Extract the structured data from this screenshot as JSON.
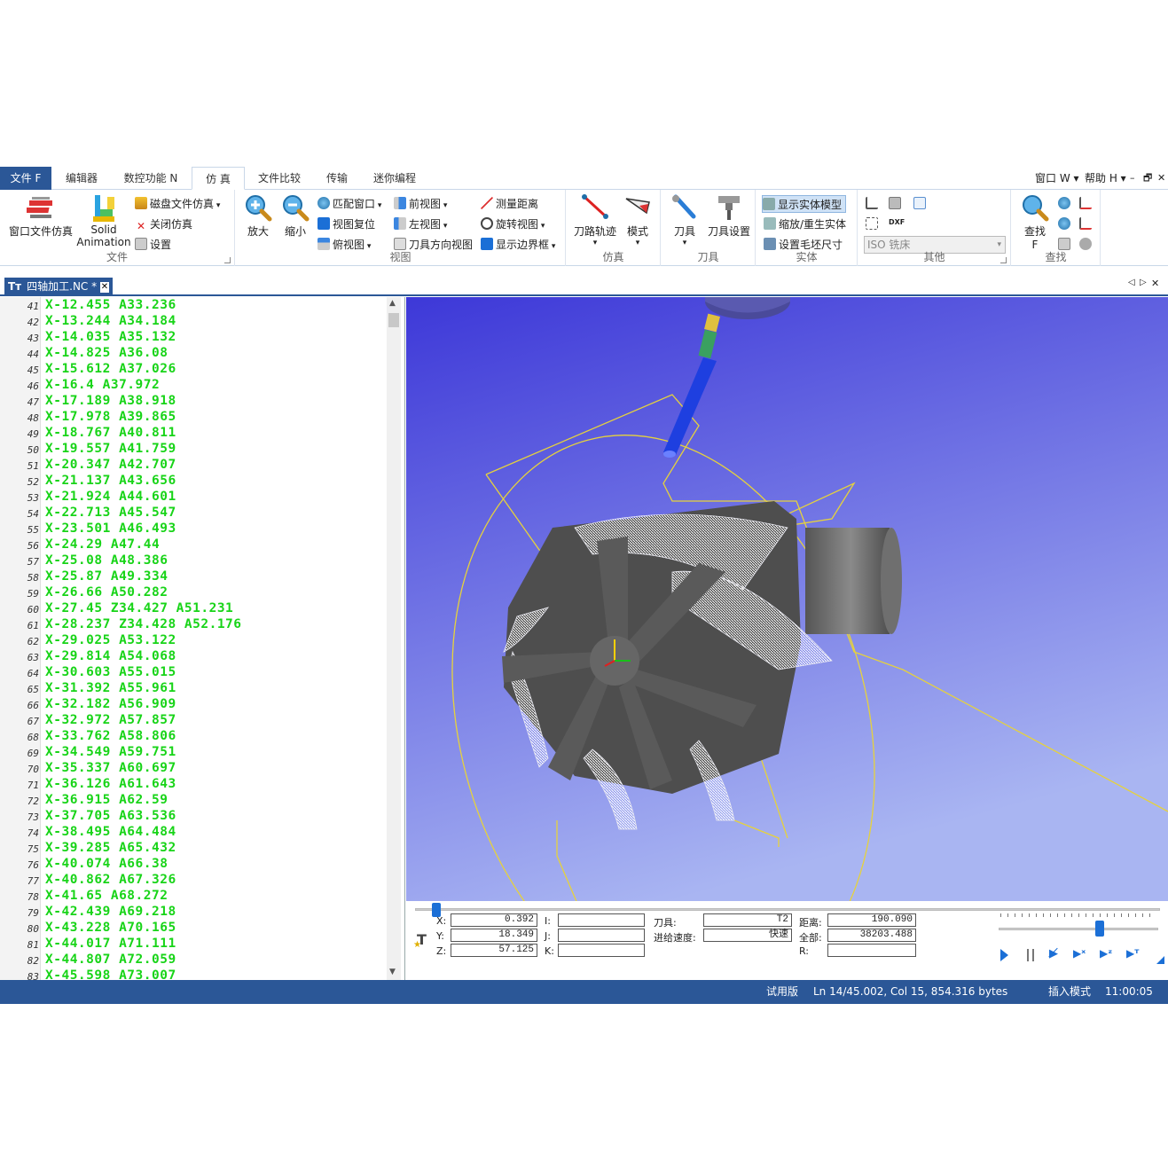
{
  "menu": {
    "file": "文件 F",
    "tabs": [
      "编辑器",
      "数控功能 N",
      "仿 真",
      "文件比较",
      "传输",
      "迷你编程"
    ],
    "window": "窗口 W",
    "help": "帮助 H",
    "window_btns": [
      "–",
      "🗗",
      "✕"
    ]
  },
  "ribbon": {
    "file_group": {
      "label": "文件",
      "window_sim": "窗口文件仿真",
      "solid_line1": "Solid",
      "solid_line2": "Animation",
      "disk_sim": "磁盘文件仿真",
      "close_sim": "关闭仿真",
      "settings": "设置"
    },
    "view_group": {
      "label": "视图",
      "zoom_in": "放大",
      "zoom_out": "缩小",
      "fit_window": "匹配窗口",
      "view_reset": "视图复位",
      "top_view": "俯视图",
      "front_view": "前视图",
      "left_view": "左视图",
      "tool_dir_view": "刀具方向视图",
      "measure": "测量距离",
      "rotate_view": "旋转视图",
      "show_bounds": "显示边界框"
    },
    "sim_group": {
      "label": "仿真",
      "toolpath": "刀路轨迹",
      "mode": "模式"
    },
    "tool_group": {
      "label": "刀具",
      "tool": "刀具",
      "tool_setup": "刀具设置"
    },
    "solid_group": {
      "label": "实体",
      "show_solid": "显示实体模型",
      "zoom_regen": "缩放/重生实体",
      "stock_size": "设置毛坯尺寸"
    },
    "other_group": {
      "label": "其他",
      "machine": "ISO 铣床",
      "dxf": "DXF"
    },
    "find_group": {
      "label": "查找",
      "find": "查找",
      "find_key": "F"
    }
  },
  "doc_tab": {
    "title": "四轴加工.NC *",
    "close": "✕",
    "nav": [
      "◁",
      "▷",
      "✕"
    ]
  },
  "editor": {
    "lines": [
      {
        "n": "41",
        "t": "X-12.455 A33.236"
      },
      {
        "n": "42",
        "t": "X-13.244 A34.184"
      },
      {
        "n": "43",
        "t": "X-14.035 A35.132"
      },
      {
        "n": "44",
        "t": "X-14.825 A36.08"
      },
      {
        "n": "45",
        "t": "X-15.612 A37.026"
      },
      {
        "n": "46",
        "t": "X-16.4 A37.972"
      },
      {
        "n": "47",
        "t": "X-17.189 A38.918"
      },
      {
        "n": "48",
        "t": "X-17.978 A39.865"
      },
      {
        "n": "49",
        "t": "X-18.767 A40.811"
      },
      {
        "n": "50",
        "t": "X-19.557 A41.759"
      },
      {
        "n": "51",
        "t": "X-20.347 A42.707"
      },
      {
        "n": "52",
        "t": "X-21.137 A43.656"
      },
      {
        "n": "53",
        "t": "X-21.924 A44.601"
      },
      {
        "n": "54",
        "t": "X-22.713 A45.547"
      },
      {
        "n": "55",
        "t": "X-23.501 A46.493"
      },
      {
        "n": "56",
        "t": "X-24.29 A47.44"
      },
      {
        "n": "57",
        "t": "X-25.08 A48.386"
      },
      {
        "n": "58",
        "t": "X-25.87 A49.334"
      },
      {
        "n": "59",
        "t": "X-26.66 A50.282"
      },
      {
        "n": "60",
        "t": "X-27.45 Z34.427 A51.231"
      },
      {
        "n": "61",
        "t": "X-28.237 Z34.428 A52.176"
      },
      {
        "n": "62",
        "t": "X-29.025 A53.122"
      },
      {
        "n": "63",
        "t": "X-29.814 A54.068"
      },
      {
        "n": "64",
        "t": "X-30.603 A55.015"
      },
      {
        "n": "65",
        "t": "X-31.392 A55.961"
      },
      {
        "n": "66",
        "t": "X-32.182 A56.909"
      },
      {
        "n": "67",
        "t": "X-32.972 A57.857"
      },
      {
        "n": "68",
        "t": "X-33.762 A58.806"
      },
      {
        "n": "69",
        "t": "X-34.549 A59.751"
      },
      {
        "n": "70",
        "t": "X-35.337 A60.697"
      },
      {
        "n": "71",
        "t": "X-36.126 A61.643"
      },
      {
        "n": "72",
        "t": "X-36.915 A62.59"
      },
      {
        "n": "73",
        "t": "X-37.705 A63.536"
      },
      {
        "n": "74",
        "t": "X-38.495 A64.484"
      },
      {
        "n": "75",
        "t": "X-39.285 A65.432"
      },
      {
        "n": "76",
        "t": "X-40.074 A66.38"
      },
      {
        "n": "77",
        "t": "X-40.862 A67.326"
      },
      {
        "n": "78",
        "t": "X-41.65 A68.272"
      },
      {
        "n": "79",
        "t": "X-42.439 A69.218"
      },
      {
        "n": "80",
        "t": "X-43.228 A70.165"
      },
      {
        "n": "81",
        "t": "X-44.017 A71.111"
      },
      {
        "n": "82",
        "t": "X-44.807 A72.059"
      },
      {
        "n": "83",
        "t": "X-45.598 A73.007"
      }
    ]
  },
  "readout": {
    "x_label": "X:",
    "x": "0.392",
    "y_label": "Y:",
    "y": "18.349",
    "z_label": "Z:",
    "z": "57.125",
    "i_label": "I:",
    "j_label": "J:",
    "k_label": "K:",
    "tool_label": "刀具:",
    "tool": "T2",
    "feed_label": "进给速度:",
    "feed": "快速",
    "dist_label": "距离:",
    "dist": "190.090",
    "total_label": "全部:",
    "total": "38203.488",
    "r_label": "R:"
  },
  "progress": {
    "sim_position": 0.02,
    "speed": 0.62
  },
  "status": {
    "trial": "试用版",
    "position": "Ln 14/45.002, Col 15, 854.316 bytes",
    "mode": "插入模式",
    "time": "11:00:05"
  },
  "colors": {
    "accent": "#2b5797",
    "code": "#18d418",
    "viewport_top": "#3d38d8",
    "viewport_bottom": "#a9b5f2"
  }
}
